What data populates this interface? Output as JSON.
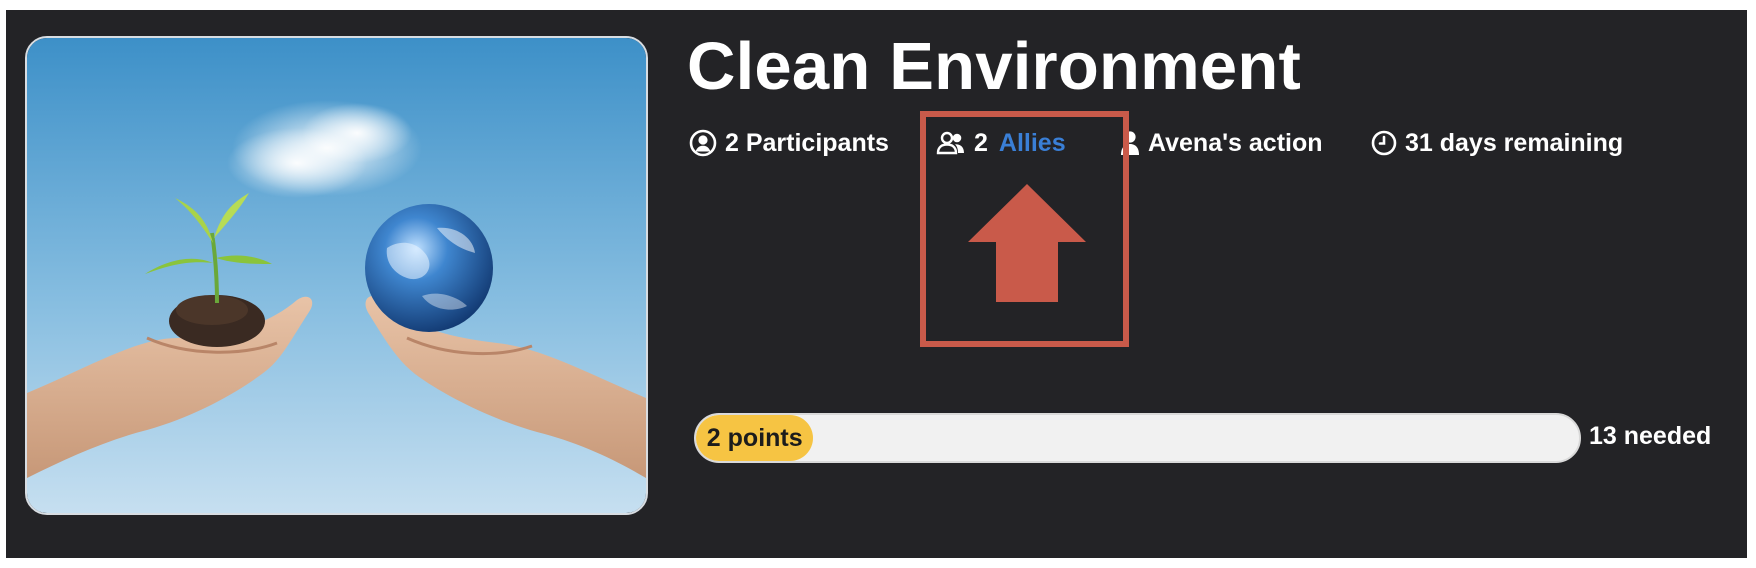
{
  "challenge": {
    "title": "Clean Environment",
    "image_alt": "Hands holding a seedling and the Earth",
    "meta": {
      "participants": {
        "icon": "user-circle-icon",
        "text": "2 Participants"
      },
      "allies": {
        "icon": "group-icon",
        "count": "2",
        "link_label": "Allies"
      },
      "action": {
        "icon": "person-icon",
        "text": "Avena's action"
      },
      "remaining": {
        "icon": "clock-icon",
        "text": "31 days remaining"
      }
    },
    "progress": {
      "label": "2 points",
      "points": 2,
      "fraction": 0.133,
      "needed_label": "13 needed"
    }
  },
  "annotation": {
    "type": "highlight-box-with-up-arrow",
    "color": "#c95a4a"
  },
  "colors": {
    "background": "#232326",
    "link": "#3a7fd6",
    "progress_fill": "#f6c443",
    "progress_track": "#f1f1f1"
  }
}
